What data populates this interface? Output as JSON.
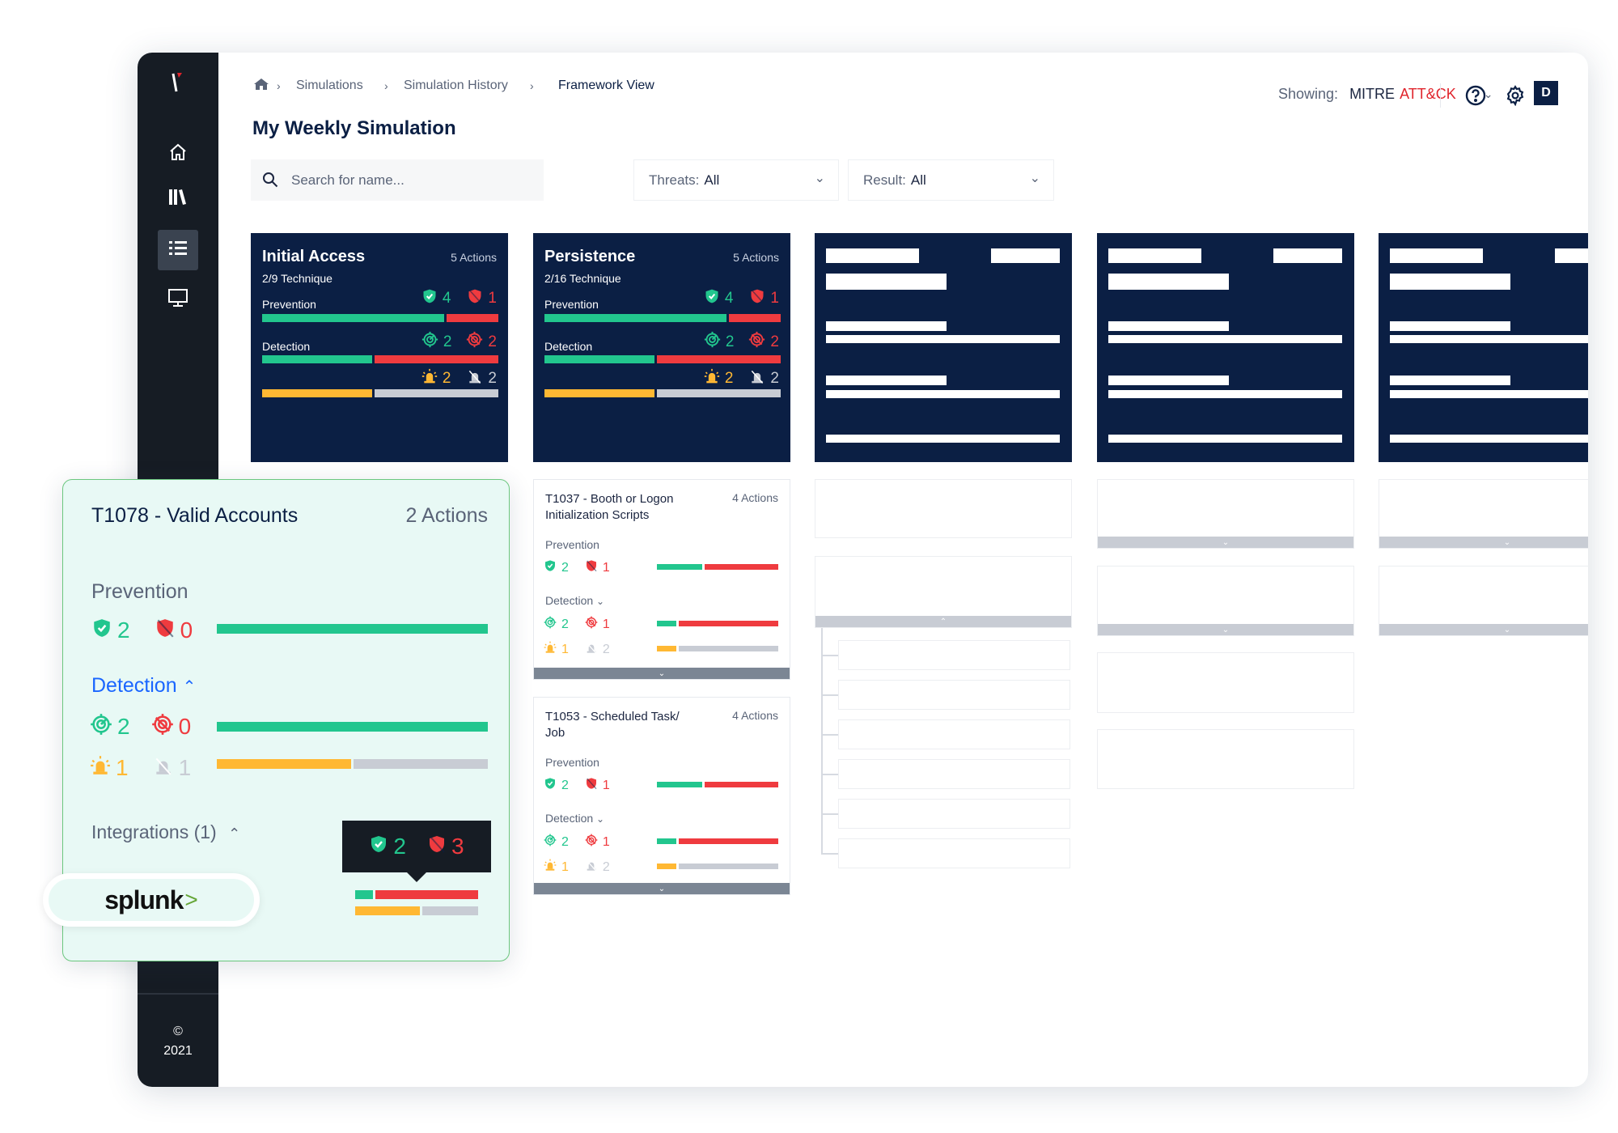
{
  "colors": {
    "navy": "#0b1f44",
    "green": "#22c68e",
    "red": "#ef3b3f",
    "yellow": "#ffb833",
    "gray": "#c8ccd4",
    "blue": "#1a66ff",
    "sidebar": "#161c24",
    "popup_bg": "#e8f9f5"
  },
  "sidebar": {
    "items": [
      {
        "icon": "home-icon"
      },
      {
        "icon": "library-icon"
      },
      {
        "icon": "list-icon",
        "active": true
      },
      {
        "icon": "monitor-icon"
      }
    ],
    "copyright": "©",
    "year": "2021"
  },
  "breadcrumb": {
    "items": [
      "Simulations",
      "Simulation History",
      "Framework View"
    ]
  },
  "header": {
    "showing_label": "Showing:",
    "framework_a": "MITRE",
    "framework_b": "ATT&CK",
    "avatar": "D"
  },
  "page_title": "My Weekly Simulation",
  "search": {
    "placeholder": "Search for name..."
  },
  "filters": {
    "threats": {
      "label": "Threats:",
      "value": "All"
    },
    "result": {
      "label": "Result:",
      "value": "All"
    }
  },
  "tactics": [
    {
      "name": "Initial Access",
      "actions": "5 Actions",
      "technique": "2/9 Technique",
      "prevention_label": "Prevention",
      "detection_label": "Detection",
      "prevented": "4",
      "not_prevented": "1",
      "detected": "2",
      "not_detected": "2",
      "alerted": "2",
      "not_alerted": "2",
      "prevention_fraction": 0.78,
      "detection_fraction": 0.47,
      "alert_fraction": 0.47
    },
    {
      "name": "Persistence",
      "actions": "5 Actions",
      "technique": "2/16 Technique",
      "prevention_label": "Prevention",
      "detection_label": "Detection",
      "prevented": "4",
      "not_prevented": "1",
      "detected": "2",
      "not_detected": "2",
      "alerted": "2",
      "not_alerted": "2",
      "prevention_fraction": 0.78,
      "detection_fraction": 0.47,
      "alert_fraction": 0.47
    }
  ],
  "techniques": [
    {
      "title": "T1037 - Booth or Logon Initialization Scripts",
      "actions": "4 Actions",
      "prevention_label": "Prevention",
      "detection_label": "Detection",
      "prevented": "2",
      "not_prevented": "1",
      "detected": "2",
      "not_detected": "1",
      "alerted": "1",
      "not_alerted": "2",
      "prevention_fraction": 0.38,
      "detection_fraction": 0.16,
      "alert_fraction": 0.16
    },
    {
      "title": "T1053 - Scheduled Task/ Job",
      "actions": "4 Actions",
      "prevention_label": "Prevention",
      "detection_label": "Detection",
      "prevented": "2",
      "not_prevented": "1",
      "detected": "2",
      "not_detected": "1",
      "alerted": "1",
      "not_alerted": "2",
      "prevention_fraction": 0.38,
      "detection_fraction": 0.16,
      "alert_fraction": 0.16
    }
  ],
  "popup": {
    "title": "T1078 - Valid Accounts",
    "actions": "2 Actions",
    "prevention_label": "Prevention",
    "detection_label": "Detection",
    "integrations_label": "Integrations (1)",
    "prevented": "2",
    "not_prevented": "0",
    "detected": "2",
    "not_detected": "0",
    "alerted": "1",
    "not_alerted": "1",
    "prevention_fraction": 1,
    "detection_fraction": 1,
    "alert_fraction": 0.5,
    "integration": {
      "name": "splunk",
      "logo_mark": ">",
      "tooltip_prevented": "2",
      "tooltip_not_prevented": "3",
      "prevention_fraction": 0.15,
      "alert_fraction": 0.54
    }
  }
}
